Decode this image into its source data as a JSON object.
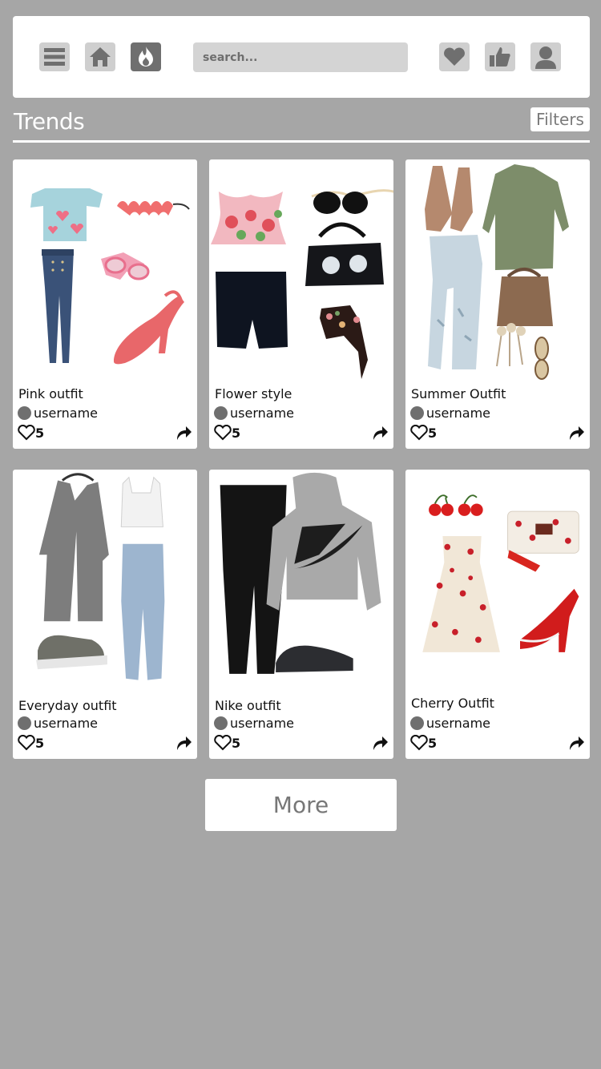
{
  "search": {
    "placeholder": "search..."
  },
  "nav": {
    "left_icons": [
      "menu-icon",
      "home-icon",
      "flame-icon"
    ],
    "right_icons": [
      "heart-icon",
      "thumbs-up-icon",
      "user-icon"
    ],
    "active": "flame-icon"
  },
  "section": {
    "title": "Trends",
    "filters_label": "Filters"
  },
  "outfits": [
    {
      "title": "Pink outfit",
      "username": "username",
      "likes": "5"
    },
    {
      "title": "Flower style",
      "username": "username",
      "likes": "5"
    },
    {
      "title": "Summer Outfit",
      "username": "username",
      "likes": "5"
    },
    {
      "title": "Everyday outfit",
      "username": "username",
      "likes": "5"
    },
    {
      "title": "Nike outfit",
      "username": "username",
      "likes": "5"
    },
    {
      "title": "Cherry Outfit",
      "username": "username",
      "likes": "5"
    }
  ],
  "more_label": "More",
  "colors": {
    "background": "#a6a6a6",
    "card": "#ffffff",
    "icon_bg": "#cfcfcf",
    "icon_active": "#6f6f6f"
  }
}
